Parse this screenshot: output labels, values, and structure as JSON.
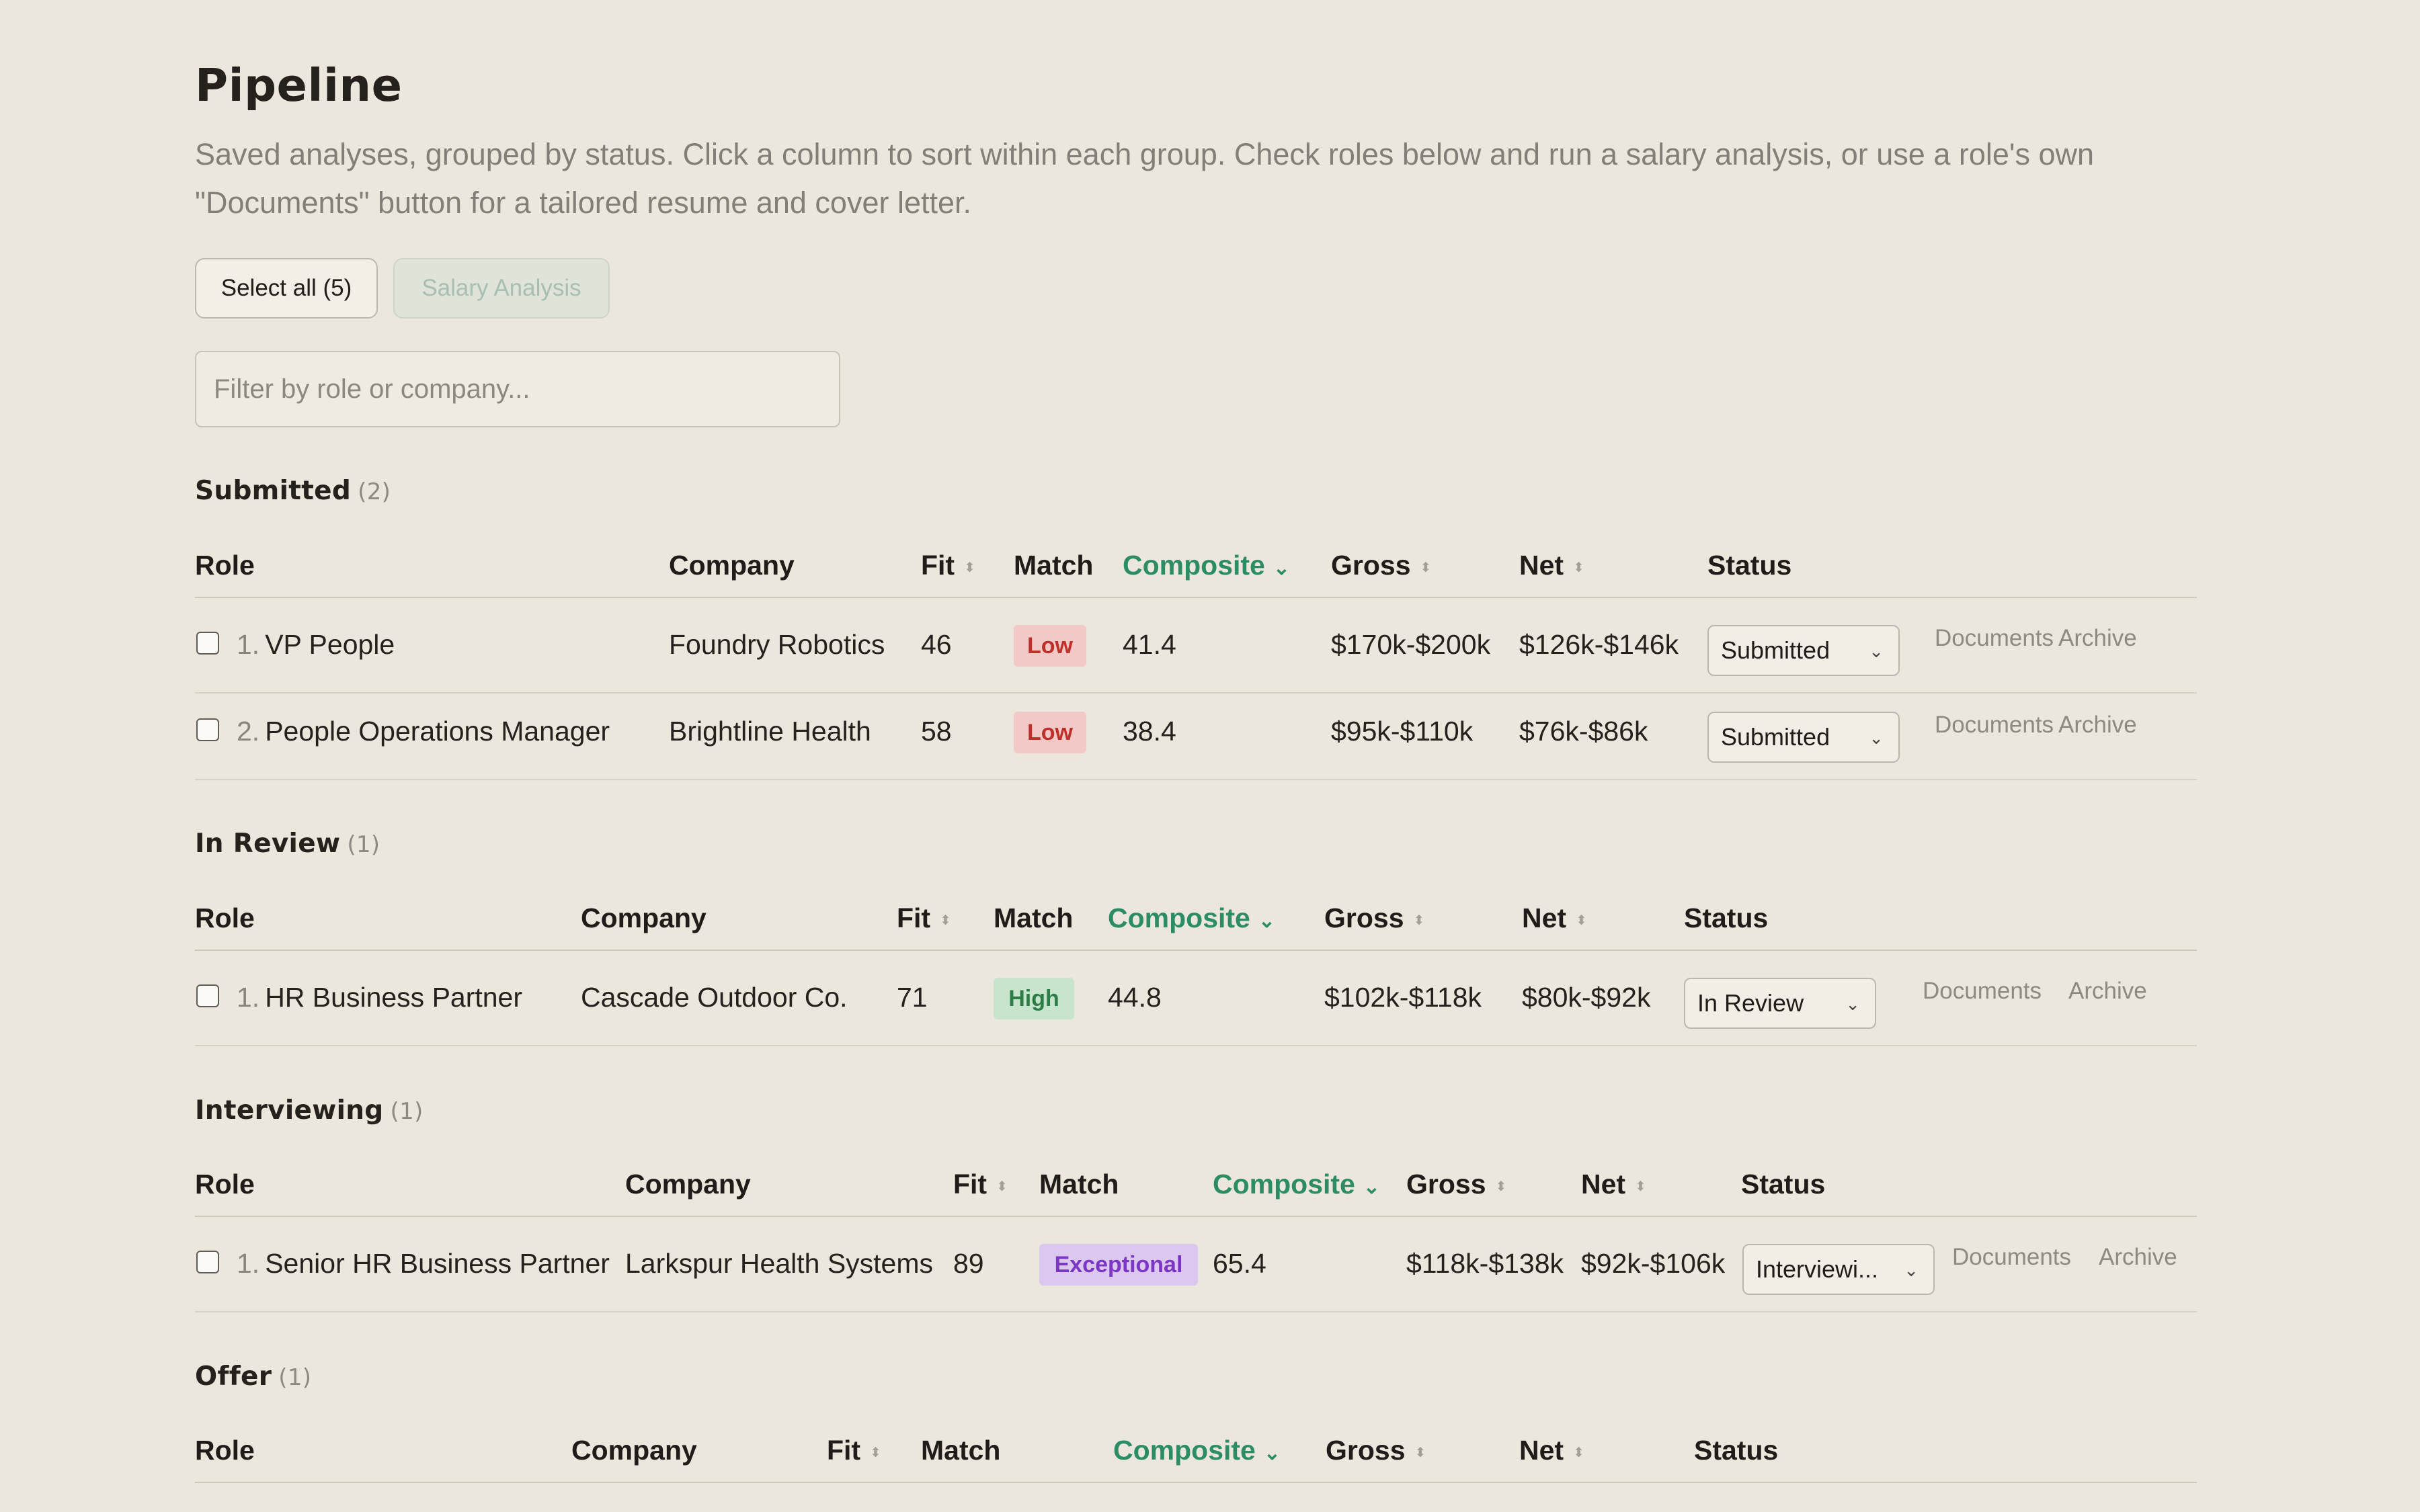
{
  "page": {
    "title": "Pipeline",
    "subtitle": "Saved analyses, grouped by status. Click a column to sort within each group. Check roles below and run a salary analysis, or use a role's own \"Documents\" button for a tailored resume and cover letter."
  },
  "toolbar": {
    "select_all_label": "Select all (5)",
    "salary_analysis_label": "Salary Analysis"
  },
  "filter": {
    "placeholder": "Filter by role or company..."
  },
  "columns": {
    "role": "Role",
    "company": "Company",
    "fit": "Fit",
    "match": "Match",
    "composite": "Composite",
    "gross": "Gross",
    "net": "Net",
    "status": "Status"
  },
  "row_actions": {
    "documents": "Documents",
    "archive": "Archive"
  },
  "colors": {
    "accent_green": "#2c8c63",
    "badge_low_bg": "#f2c9c6",
    "badge_low_fg": "#c0302a",
    "badge_high_bg": "#c8e4cd",
    "badge_high_fg": "#2d7e46",
    "badge_exceptional_bg": "#dcc8ef",
    "badge_exceptional_fg": "#7c36c6"
  },
  "icons": {
    "sort_idle": "sort-icon",
    "sort_active": "chevron-down-icon",
    "select": "chevron-down-icon"
  },
  "groups": [
    {
      "name": "Submitted",
      "count": "(2)",
      "rows": [
        {
          "index": "1.",
          "role": "VP People",
          "company": "Foundry Robotics",
          "fit": "46",
          "match": "Low",
          "composite": "41.4",
          "gross": "$170k-$200k",
          "net": "$126k-$146k",
          "status": "Submitted"
        },
        {
          "index": "2.",
          "role": "People Operations Manager",
          "company": "Brightline Health",
          "fit": "58",
          "match": "Low",
          "composite": "38.4",
          "gross": "$95k-$110k",
          "net": "$76k-$86k",
          "status": "Submitted"
        }
      ]
    },
    {
      "name": "In Review",
      "count": "(1)",
      "rows": [
        {
          "index": "1.",
          "role": "HR Business Partner",
          "company": "Cascade Outdoor Co.",
          "fit": "71",
          "match": "High",
          "composite": "44.8",
          "gross": "$102k-$118k",
          "net": "$80k-$92k",
          "status": "In Review"
        }
      ]
    },
    {
      "name": "Interviewing",
      "count": "(1)",
      "rows": [
        {
          "index": "1.",
          "role": "Senior HR Business Partner",
          "company": "Larkspur Health Systems",
          "fit": "89",
          "match": "Exceptional",
          "composite": "65.4",
          "gross": "$118k-$138k",
          "net": "$92k-$106k",
          "status": "Interviewi..."
        }
      ]
    },
    {
      "name": "Offer",
      "count": "(1)",
      "rows": []
    }
  ]
}
